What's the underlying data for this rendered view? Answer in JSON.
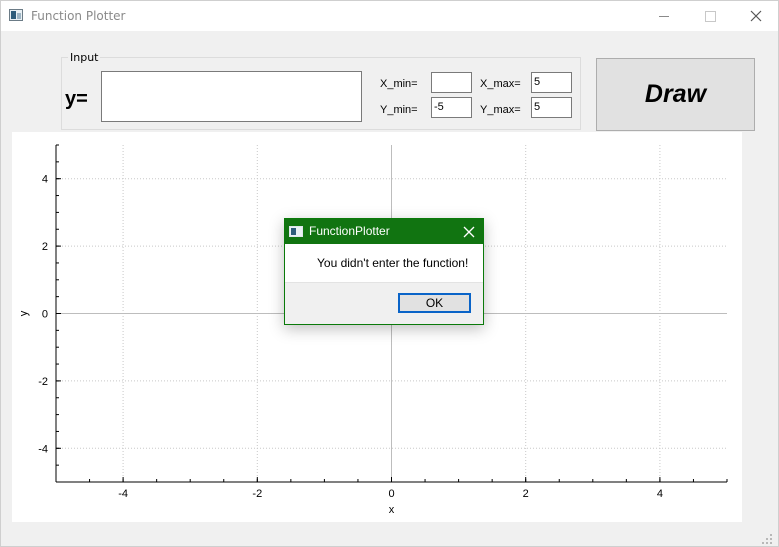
{
  "window": {
    "title": "Function Plotter"
  },
  "input_group": {
    "title": "Input",
    "y_label": "y=",
    "function_value": "",
    "x_min_label": "X_min=",
    "x_min_value": "",
    "x_max_label": "X_max=",
    "x_max_value": "5",
    "y_min_label": "Y_min=",
    "y_min_value": "-5",
    "y_max_label": "Y_max=",
    "y_max_value": "5"
  },
  "draw_button": {
    "label": "Draw"
  },
  "chart_data": {
    "type": "line",
    "xlabel": "x",
    "ylabel": "y",
    "xlim": [
      -5,
      5
    ],
    "ylim": [
      -5,
      5
    ],
    "x_ticks": [
      -4,
      -2,
      0,
      2,
      4
    ],
    "y_ticks": [
      -4,
      -2,
      0,
      2,
      4
    ],
    "x_tick_labels": [
      "-4",
      "-2",
      "0",
      "2",
      "4"
    ],
    "y_tick_labels": [
      "-4",
      "-2",
      "0",
      "2",
      "4"
    ],
    "grid": "dotted",
    "series": []
  },
  "dialog": {
    "title": "FunctionPlotter",
    "message": "You didn't enter the function!",
    "ok_label": "OK"
  },
  "colors": {
    "dialog_titlebar": "#117411",
    "ok_focus_border": "#0a64c8",
    "grid": "#c8c8c8"
  }
}
